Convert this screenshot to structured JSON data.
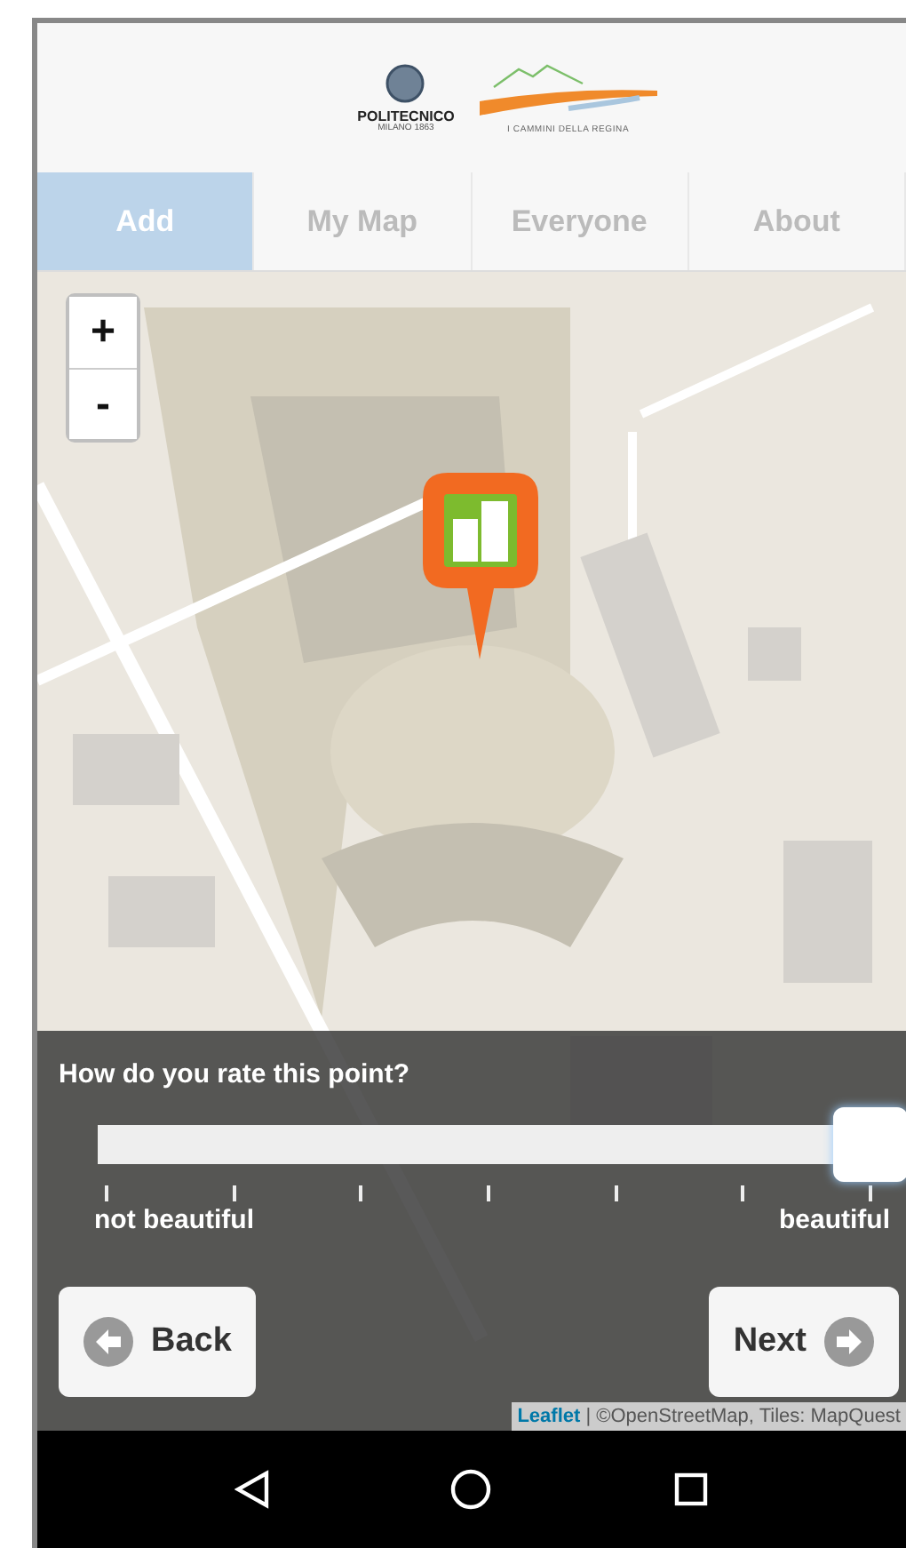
{
  "header": {
    "logos": [
      {
        "kind": "university",
        "name": "POLITECNICO",
        "subtitle": "MILANO 1863"
      },
      {
        "kind": "project",
        "name": "I CAMMINI DELLA REGINA"
      }
    ]
  },
  "tabs": [
    {
      "label": "Add",
      "selected": true
    },
    {
      "label": "My Map",
      "selected": false
    },
    {
      "label": "Everyone",
      "selected": false
    },
    {
      "label": "About",
      "selected": false
    }
  ],
  "map": {
    "zoom_in": "+",
    "zoom_out": "-",
    "attribution": {
      "link": "Leaflet",
      "text": "| ©OpenStreetMap, Tiles: MapQuest"
    }
  },
  "rating": {
    "question": "How do you rate this point?",
    "level": 1,
    "min_label": "not beautiful",
    "max_label": "beautiful"
  },
  "buttons": [
    {
      "kind": "back",
      "label": "Back"
    },
    {
      "kind": "next",
      "label": "Next"
    }
  ]
}
